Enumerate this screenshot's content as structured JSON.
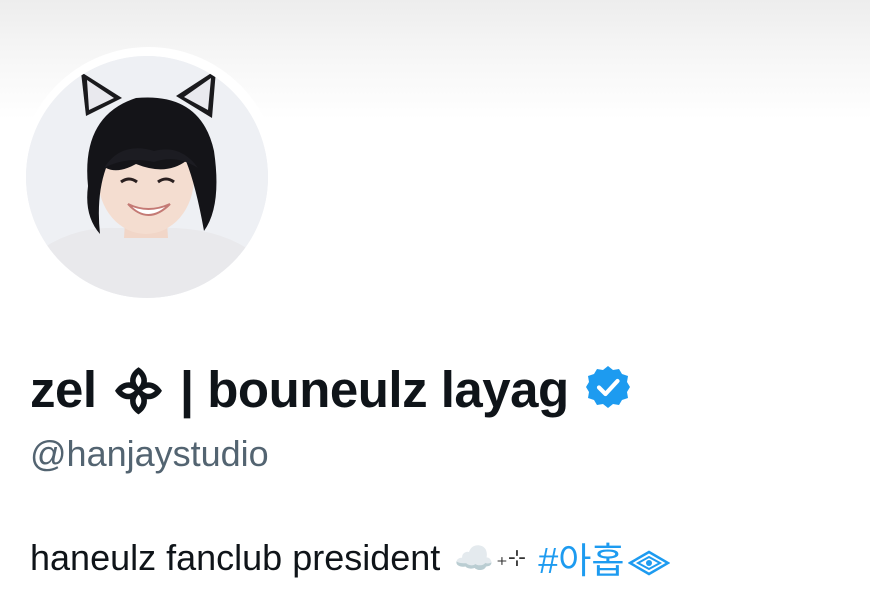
{
  "profile": {
    "display_name": "zel ᯽ | bouneulz layag",
    "handle": "@hanjaystudio",
    "verified": true,
    "avatar_icon": "profile-photo-cat-ears",
    "bio": {
      "text": "haneulz fanclub president",
      "emoji": "☁️",
      "sparkle": "₊⊹",
      "hashtag": "#아홉",
      "hashtag_icon": "diamond-eye-icon"
    }
  },
  "colors": {
    "verified_blue": "#1d9bf0",
    "handle_gray": "#536471",
    "link_blue": "#1d9bf0",
    "text": "#0f1419"
  }
}
